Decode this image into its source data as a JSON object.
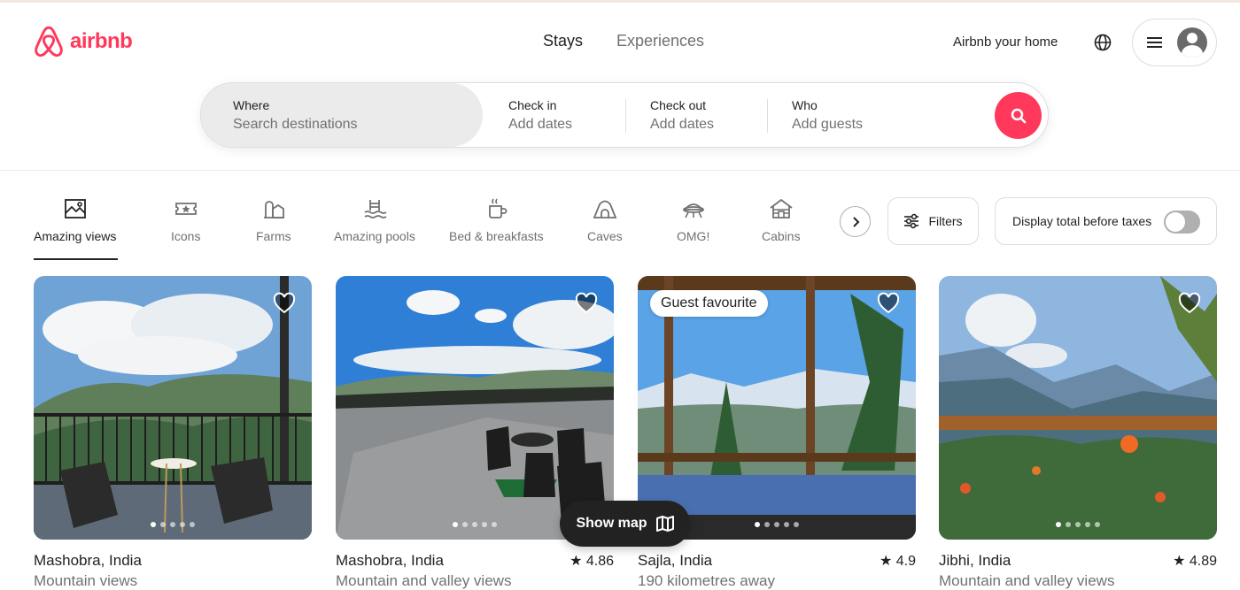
{
  "brand": {
    "name": "airbnb",
    "color": "#ff385c"
  },
  "nav": {
    "tabs": [
      "Stays",
      "Experiences"
    ],
    "active": "Stays"
  },
  "header": {
    "host_link": "Airbnb your home",
    "globe_icon": "globe-icon",
    "menu_icon": "hamburger-menu-icon"
  },
  "search": {
    "where": {
      "label": "Where",
      "placeholder": "Search destinations"
    },
    "checkin": {
      "label": "Check in",
      "placeholder": "Add dates"
    },
    "checkout": {
      "label": "Check out",
      "placeholder": "Add dates"
    },
    "who": {
      "label": "Who",
      "placeholder": "Add guests"
    },
    "button_icon": "search-icon"
  },
  "categories": [
    {
      "label": "Amazing views",
      "icon": "amazing-views-icon",
      "active": true
    },
    {
      "label": "Icons",
      "icon": "icons-icon"
    },
    {
      "label": "Farms",
      "icon": "farms-icon"
    },
    {
      "label": "Amazing pools",
      "icon": "amazing-pools-icon"
    },
    {
      "label": "Bed & breakfasts",
      "icon": "bed-breakfast-icon"
    },
    {
      "label": "Caves",
      "icon": "caves-icon"
    },
    {
      "label": "OMG!",
      "icon": "omg-icon"
    },
    {
      "label": "Cabins",
      "icon": "cabins-icon"
    }
  ],
  "filters": {
    "label": "Filters",
    "icon": "filters-icon"
  },
  "taxes_toggle": {
    "label": "Display total before taxes",
    "on": false
  },
  "listings": [
    {
      "title": "Mashobra, India",
      "subtitle": "Mountain views",
      "rating": "",
      "badge": "",
      "dots": 5,
      "active_dot": 0
    },
    {
      "title": "Mashobra, India",
      "subtitle": "Mountain and valley views",
      "rating": "4.86",
      "badge": "",
      "dots": 5,
      "active_dot": 0
    },
    {
      "title": "Sajla, India",
      "subtitle": "190 kilometres away",
      "rating": "4.9",
      "badge": "Guest favourite",
      "dots": 5,
      "active_dot": 0
    },
    {
      "title": "Jibhi, India",
      "subtitle": "Mountain and valley views",
      "rating": "4.89",
      "badge": "",
      "dots": 5,
      "active_dot": 0
    }
  ],
  "show_map": {
    "label": "Show map",
    "icon": "map-icon"
  }
}
